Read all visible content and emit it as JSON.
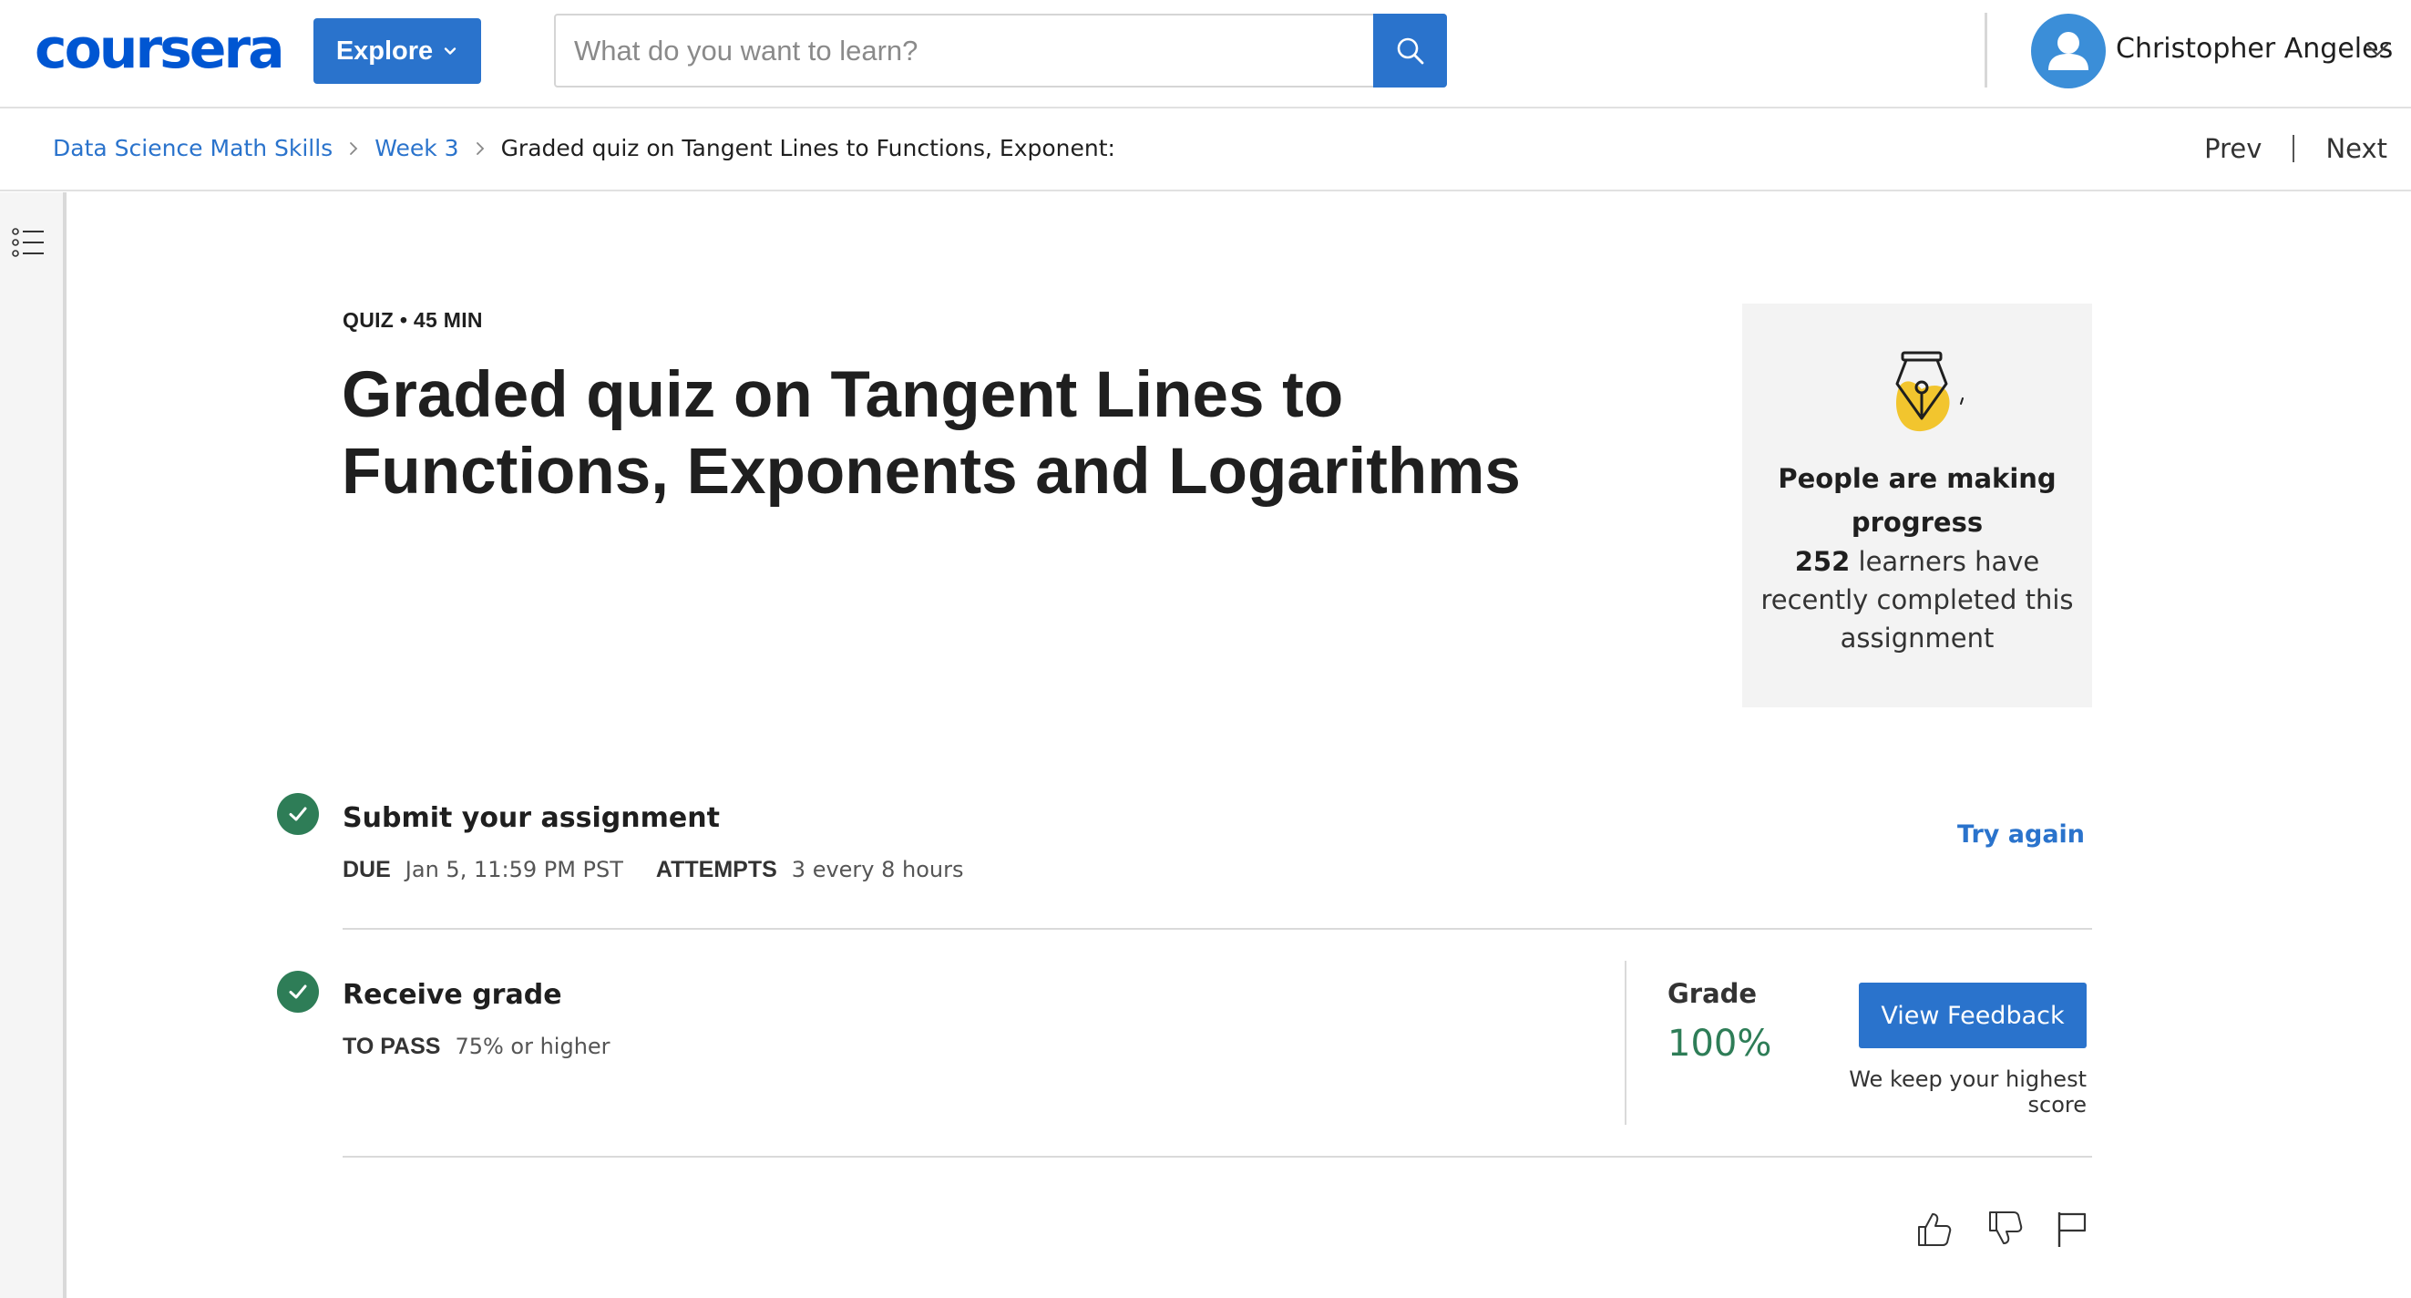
{
  "header": {
    "logo_text": "coursera",
    "explore_label": "Explore",
    "search": {
      "placeholder": "What do you want to learn?",
      "value": ""
    },
    "user_name": "Christopher Angeles"
  },
  "breadcrumb": {
    "items": [
      "Data Science Math Skills",
      "Week 3"
    ],
    "current": "Graded quiz on Tangent Lines to Functions, Exponent:"
  },
  "nav": {
    "prev_label": "Prev",
    "next_label": "Next"
  },
  "quiz": {
    "kicker": "QUIZ • 45 MIN",
    "title": "Graded quiz on Tangent Lines to Functions, Exponents and Logarithms"
  },
  "progress_card": {
    "heading": "People are making progress",
    "count": "252",
    "body_rest": " learners have recently completed this assignment"
  },
  "submit_step": {
    "title": "Submit your assignment",
    "due_label": "DUE",
    "due_value": "Jan 5, 11:59 PM PST",
    "attempts_label": "ATTEMPTS",
    "attempts_value": "3 every 8 hours",
    "try_again_label": "Try again"
  },
  "grade_step": {
    "title": "Receive grade",
    "to_pass_label": "TO PASS",
    "to_pass_value": "75% or higher",
    "grade_label": "Grade",
    "grade_value": "100%",
    "feedback_button": "View Feedback",
    "note": "We keep your highest score"
  },
  "colors": {
    "brand_blue": "#0056d2",
    "button_blue": "#2a73cc",
    "success_green": "#2e7d57",
    "badge_yellow": "#f2c52e"
  },
  "icons": [
    "search-icon",
    "chevron-down-icon",
    "avatar-person-icon",
    "chevron-right-icon",
    "table-of-contents-icon",
    "pen-nib-icon",
    "checkmark-icon",
    "thumbs-up-icon",
    "thumbs-down-icon",
    "flag-icon"
  ]
}
